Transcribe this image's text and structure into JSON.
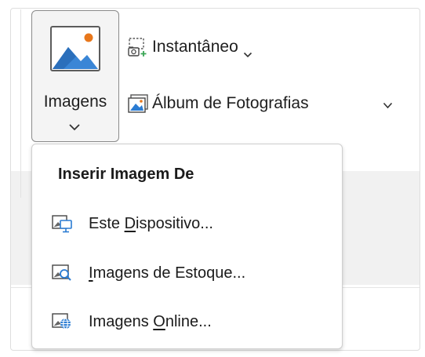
{
  "ribbon": {
    "imagens_button": {
      "label": "Imagens",
      "icon": "picture-icon"
    },
    "instantaneo": {
      "label": "Instantâneo",
      "icon": "screenshot-icon",
      "has_dropdown": true
    },
    "album": {
      "label": "Álbum de Fotografias",
      "icon": "photo-album-icon",
      "has_dropdown": true
    }
  },
  "menu": {
    "title": "Inserir Imagem De",
    "items": [
      {
        "pre": "Este ",
        "accel": "D",
        "post": "ispositivo...",
        "icon": "this-device-icon"
      },
      {
        "pre": "",
        "accel": "I",
        "post": "magens de Estoque...",
        "icon": "stock-images-icon"
      },
      {
        "pre": "Imagens ",
        "accel": "O",
        "post": "nline...",
        "icon": "online-images-icon"
      }
    ]
  },
  "colors": {
    "accent_blue": "#2b7cd3",
    "icon_orange": "#e8771b",
    "icon_green": "#3aa655"
  }
}
